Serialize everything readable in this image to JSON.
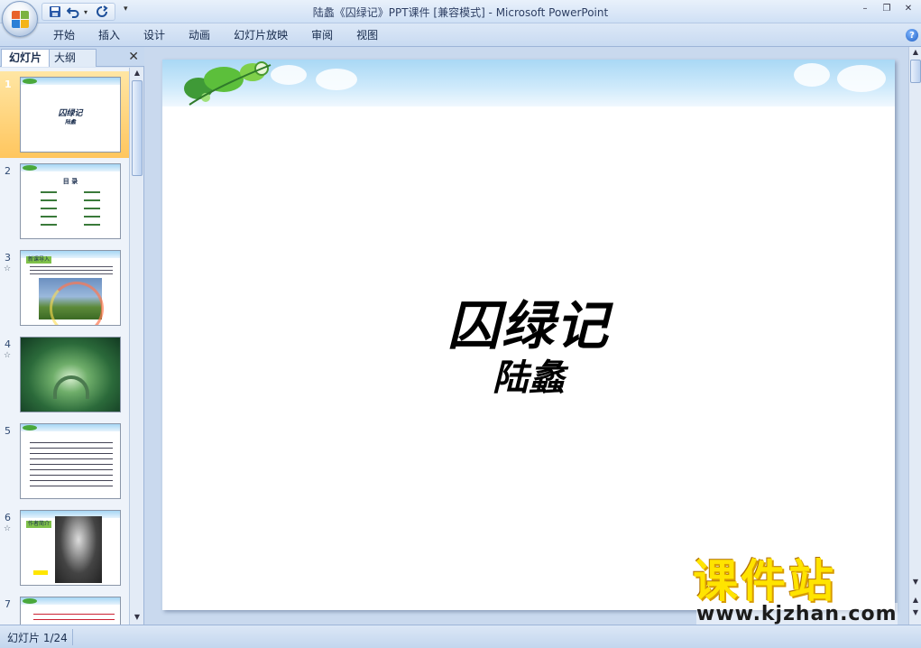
{
  "window": {
    "title": "陆蠡《囚绿记》PPT课件 [兼容模式] - Microsoft PowerPoint",
    "minimize": "–",
    "restore": "❐",
    "close": "✕"
  },
  "quick_access": [
    "save-icon",
    "undo-icon",
    "redo-icon"
  ],
  "ribbon": {
    "tabs": [
      "开始",
      "插入",
      "设计",
      "动画",
      "幻灯片放映",
      "审阅",
      "视图"
    ],
    "help": "?"
  },
  "pane": {
    "tabs": [
      "幻灯片",
      "大纲"
    ],
    "close": "✕"
  },
  "thumbnails": [
    {
      "num": "1",
      "star": "",
      "title": "囚绿记",
      "sub": "陆蠡"
    },
    {
      "num": "2",
      "star": "",
      "title": "目 录"
    },
    {
      "num": "3",
      "star": "☆",
      "label": "新课导入"
    },
    {
      "num": "4",
      "star": "☆"
    },
    {
      "num": "5",
      "star": ""
    },
    {
      "num": "6",
      "star": "☆",
      "label": "作者简介"
    },
    {
      "num": "7",
      "star": ""
    }
  ],
  "slide": {
    "title": "囚绿记",
    "author": "陆蠡"
  },
  "watermark": {
    "text": "课件站",
    "url": "www.kjzhan.com"
  },
  "status": {
    "slide_info": "幻灯片 1/24"
  },
  "colors": {
    "ribbon_bg": "#c8daf1",
    "selected_thumb": "#ffc65e",
    "watermark_yellow": "#ffe400"
  }
}
